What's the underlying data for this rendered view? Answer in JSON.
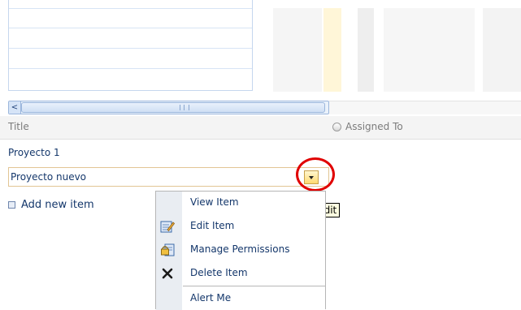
{
  "scrollbar": {
    "left_arrow": "<",
    "grip": "III"
  },
  "header": {
    "title_col": "Title",
    "assigned_col": "Assigned To"
  },
  "rows": [
    {
      "title": "Proyecto 1"
    },
    {
      "title": "Proyecto nuevo"
    }
  ],
  "add_new": "Add new item",
  "tooltip": "Edit",
  "menu": {
    "items": [
      {
        "label": "View Item",
        "icon": "none"
      },
      {
        "label": "Edit Item",
        "icon": "edit-icon"
      },
      {
        "label": "Manage Permissions",
        "icon": "permissions-icon"
      },
      {
        "label": "Delete Item",
        "icon": "delete-icon"
      },
      {
        "label": "Alert Me",
        "icon": "none"
      }
    ]
  },
  "colors": {
    "highlight_column": "#fff6d8",
    "accent_red": "#e00000",
    "link_blue": "#14376b"
  }
}
